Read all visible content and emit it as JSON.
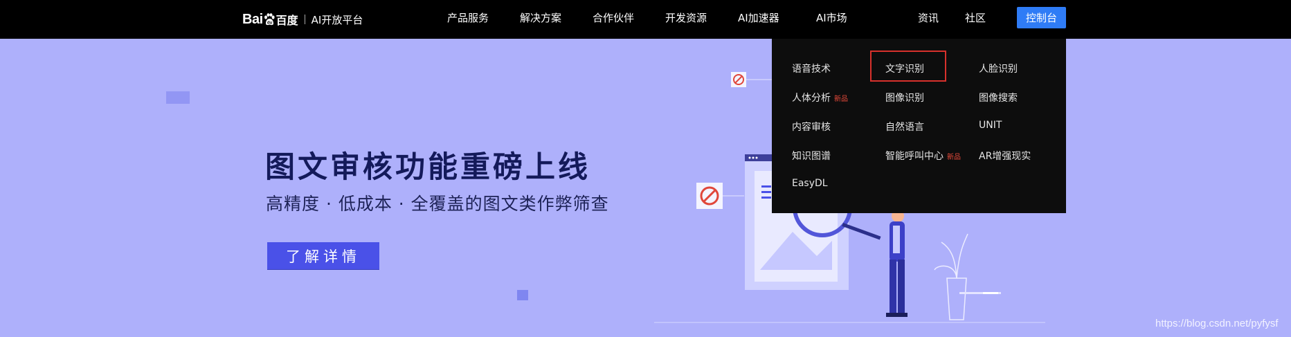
{
  "nav": {
    "logo": {
      "brand": "Bai",
      "brand_cn": "百度",
      "platform": "AI开放平台"
    },
    "items": [
      "产品服务",
      "解决方案",
      "合作伙伴",
      "开发资源",
      "AI加速器",
      "AI市场",
      "资讯",
      "社区"
    ],
    "console_label": "控制台"
  },
  "hero": {
    "title": "图文审核功能重磅上线",
    "subtitle": "高精度 · 低成本 · 全覆盖的图文类作弊筛查",
    "button_label": "了解详情"
  },
  "dropdown": {
    "columns": [
      [
        {
          "label": "语音技术"
        },
        {
          "label": "人体分析",
          "badge": "新品"
        },
        {
          "label": "内容审核"
        },
        {
          "label": "知识图谱"
        },
        {
          "label": "EasyDL"
        }
      ],
      [
        {
          "label": "文字识别",
          "highlighted": true
        },
        {
          "label": "图像识别"
        },
        {
          "label": "自然语言"
        },
        {
          "label": "智能呼叫中心",
          "badge": "新品"
        }
      ],
      [
        {
          "label": "人脸识别"
        },
        {
          "label": "图像搜索"
        },
        {
          "label": "UNIT"
        },
        {
          "label": "AR增强现实"
        }
      ]
    ]
  },
  "watermark": "https://blog.csdn.net/pyfysf",
  "colors": {
    "nav_bg": "#000000",
    "hero_bg": "#aeb0fb",
    "accent": "#2f7cf6",
    "button": "#4a51e8",
    "highlight": "#d8312c",
    "badge": "#e84a3a"
  }
}
